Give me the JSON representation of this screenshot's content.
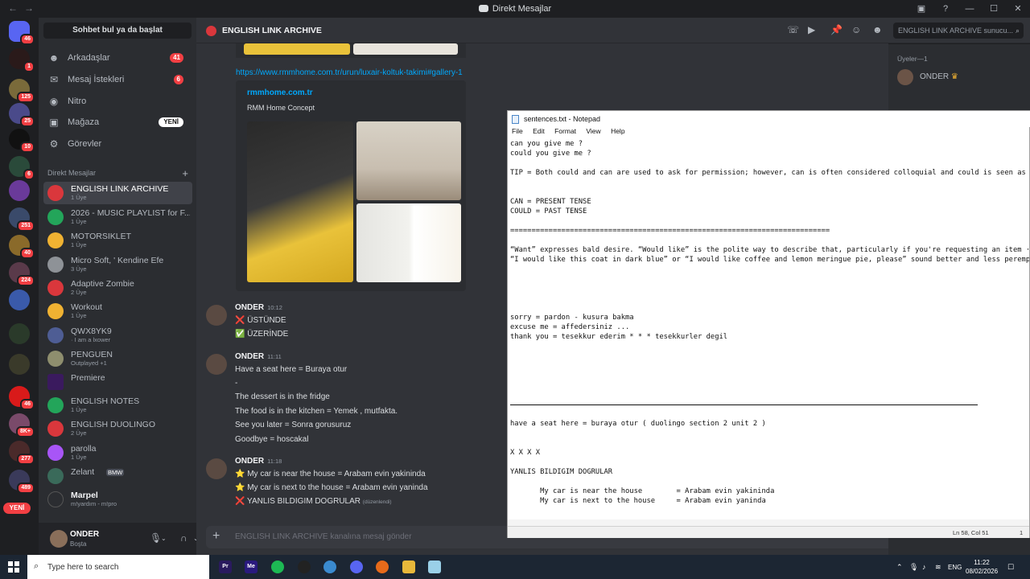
{
  "window": {
    "title": "Direkt Mesajlar"
  },
  "sidebar": {
    "find_label": "Sohbet bul ya da başlat",
    "nav": [
      {
        "label": "Arkadaşlar",
        "badge": "41",
        "icon": "friends-icon"
      },
      {
        "label": "Mesaj İstekleri",
        "badge": "6",
        "icon": "mail-icon"
      },
      {
        "label": "Nitro",
        "badge": "",
        "icon": "nitro-icon"
      },
      {
        "label": "Mağaza",
        "badge": "YENİ",
        "icon": "shop-icon"
      },
      {
        "label": "Görevler",
        "badge": "",
        "icon": "quests-icon"
      }
    ],
    "dm_header": "Direkt Mesajlar",
    "dms": [
      {
        "name": "ENGLISH LINK ARCHIVE",
        "sub": "1 Üye",
        "color": "#da373c"
      },
      {
        "name": "2026 - MUSIC PLAYLIST for F...",
        "sub": "1 Üye",
        "color": "#23a55a"
      },
      {
        "name": "MOTORSIKLET",
        "sub": "1 Üye",
        "color": "#f0b232"
      },
      {
        "name": "Micro Soft, ' Kendine Efe",
        "sub": "3 Üye",
        "color": "#8e9297"
      },
      {
        "name": "Adaptive Zombie",
        "sub": "2 Üye",
        "color": "#da373c"
      },
      {
        "name": "Workout",
        "sub": "1 Üye",
        "color": "#f0b232"
      },
      {
        "name": "QWX8YK9",
        "sub": "· I am a lxower",
        "color": "#4e5d94"
      },
      {
        "name": "PENGUEN",
        "sub": "Outplayed +1",
        "color": "#8e8e6e"
      },
      {
        "name": "Premiere",
        "sub": "",
        "color": "#3a1a5e"
      },
      {
        "name": "ENGLISH NOTES",
        "sub": "1 Üye",
        "color": "#23a55a"
      },
      {
        "name": "ENGLISH DUOLINGO",
        "sub": "2 Üye",
        "color": "#da373c"
      },
      {
        "name": "parolla",
        "sub": "1 Üye",
        "color": "#a855f7"
      },
      {
        "name": "Zelant",
        "sub": "BMW",
        "color": "#3a6a5a"
      },
      {
        "name": "Marpel",
        "sub": "m!yardım - m!pro",
        "color": "#2b2d31"
      }
    ],
    "user": {
      "name": "ONDER",
      "status": "Boşta"
    }
  },
  "chat": {
    "channel": "ENGLISH LINK ARCHIVE",
    "search_placeholder": "ENGLISH LINK ARCHIVE sunucu...",
    "link": "https://www.rmmhome.com.tr/urun/luxair-koltuk-takimi#gallery-1",
    "embed": {
      "provider": "rmmhome.com.tr",
      "desc": "RMM Home Concept"
    },
    "messages": [
      {
        "author": "ONDER",
        "time": "10:12",
        "lines": [
          "❌ ÜSTÜNDE",
          "✅ ÜZERİNDE"
        ]
      },
      {
        "author": "ONDER",
        "time": "11:11",
        "lines": [
          "Have a seat here = Buraya otur",
          "-",
          "The dessert is in the fridge",
          "The food is in the kitchen = Yemek , mutfakta.",
          "See you later = Sonra gorusuruz",
          "Goodbye = hoscakal"
        ]
      },
      {
        "author": "ONDER",
        "time": "11:18",
        "lines": [
          "⭐ My car is near the house = Arabam evin yakininda",
          "⭐ My car is next to the house = Arabam evin yaninda",
          "❌ YANLIS BILDIGIM DOGRULAR"
        ],
        "edited": "(düzenlendi)"
      }
    ],
    "composer_placeholder": "ENGLISH LINK ARCHIVE kanalına mesaj gönder"
  },
  "members": {
    "header": "Üyeler—1",
    "name": "ONDER"
  },
  "notepad": {
    "title": "sentences.txt - Notepad",
    "menu": [
      "File",
      "Edit",
      "Format",
      "View",
      "Help"
    ],
    "lines": [
      "can you give me ?",
      "could you give me ?",
      "",
      "TIP = Both could and can are used to ask for permission; however, can is often considered colloquial and could is seen as",
      "",
      "",
      "CAN = PRESENT TENSE",
      "COULD = PAST TENSE",
      "",
      "===========================================================================",
      "",
      "“Want” expresses bald desire. “Would like” is the polite way to describe that, particularly if you're requesting an item ·",
      "“I would like this coat in dark blue” or “I would like coffee and lemon meringue pie, please” sound better and less peremp",
      "",
      "",
      "",
      "",
      "",
      "sorry = pardon - kusura bakma",
      "excuse me = affedersiniz ...",
      "thank you = tesekkur ederim * * * tesekkurler degil",
      "",
      "",
      "",
      "",
      "",
      "",
      "",
      "",
      "have a seat here = buraya otur ( duolingo section 2 unit 2 )",
      "",
      "",
      "X X X X",
      "",
      "YANLIS BILDIGIM DOGRULAR",
      "",
      "       My car is near the house        = Arabam evin yakininda",
      "       My car is next to the house     = Arabam evin yaninda"
    ],
    "status_pos": "Ln 58, Col 51",
    "status_right": "1"
  },
  "taskbar": {
    "search": "Type here to search",
    "lang": "ENG",
    "time": "11:22",
    "date": "08/02/2026"
  },
  "rail_new": "YENİ"
}
